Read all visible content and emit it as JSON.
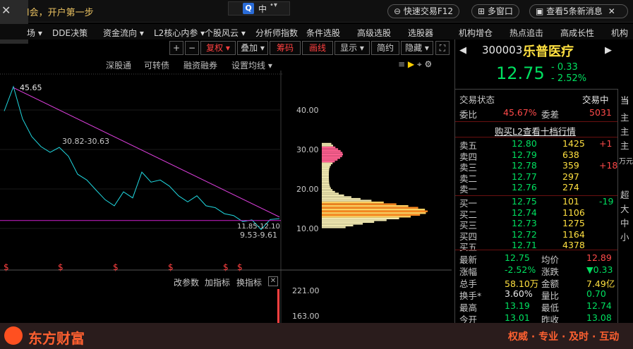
{
  "top": {
    "announcement": "l会，开户第一步",
    "center_glyph": "中",
    "quick_trade": "快速交易F12",
    "multi_window": "多窗口",
    "news": "查看5条新消息"
  },
  "menu": [
    "场",
    "DDE决策",
    "资金流向",
    "L2核心内参",
    "个股风云",
    "分析师指数",
    "条件选股",
    "高级选股",
    "选股器",
    "机构增仓",
    "热点追击",
    "高成长性",
    "机构"
  ],
  "toolbar": {
    "plus": "+",
    "minus": "−",
    "fuquan": "复权",
    "diejia": "叠加",
    "choumao": "筹码",
    "huaxian": "画线",
    "xianshi": "显示",
    "jianyue": "简约",
    "yincang": "隐藏"
  },
  "subtabs": [
    "深股通",
    "可转债",
    "融资融券",
    "设置均线"
  ],
  "chart_data": {
    "type": "line",
    "annotations": [
      "45.65",
      "30.82-30.63",
      "11.85-12.10",
      "9.53-9.61"
    ],
    "yticks": [
      "40.00",
      "30.00",
      "20.00",
      "10.00"
    ],
    "lower_yticks": [
      "221.00",
      "163.00"
    ],
    "marker": "$",
    "series": [
      {
        "values": [
          40,
          45.65,
          38,
          33,
          31,
          29,
          30.8,
          28,
          24,
          22,
          20,
          17,
          16,
          19,
          18,
          24,
          22,
          22,
          21,
          18,
          17,
          18,
          16,
          15,
          14,
          13,
          12,
          11.9,
          10,
          12,
          12.75
        ]
      }
    ],
    "trendline": {
      "from": 45.65,
      "to": 12.9
    },
    "support_level": 12.0
  },
  "lower_panel": {
    "params": "改参数",
    "add": "加指标",
    "switch": "换指标"
  },
  "stock": {
    "code": "300003",
    "name": "乐普医疗",
    "price": "12.75",
    "change": "- 0.33",
    "pct": "- 2.52%",
    "status_label": "交易状态",
    "status_value": "交易中",
    "weibi_label": "委比",
    "weibi_value": "45.67%",
    "weicha_label": "委差",
    "weicha_value": "5031",
    "l2_link": "购买L2查看十档行情"
  },
  "asks": [
    {
      "label": "卖五",
      "price": "12.80",
      "vol": "1425",
      "chg": "+1"
    },
    {
      "label": "卖四",
      "price": "12.79",
      "vol": "638",
      "chg": ""
    },
    {
      "label": "卖三",
      "price": "12.78",
      "vol": "359",
      "chg": "+18"
    },
    {
      "label": "卖二",
      "price": "12.77",
      "vol": "297",
      "chg": ""
    },
    {
      "label": "卖一",
      "price": "12.76",
      "vol": "274",
      "chg": ""
    }
  ],
  "bids": [
    {
      "label": "买一",
      "price": "12.75",
      "vol": "101",
      "chg": "-19"
    },
    {
      "label": "买二",
      "price": "12.74",
      "vol": "1106",
      "chg": ""
    },
    {
      "label": "买三",
      "price": "12.73",
      "vol": "1275",
      "chg": ""
    },
    {
      "label": "买四",
      "price": "12.72",
      "vol": "1164",
      "chg": ""
    },
    {
      "label": "买五",
      "price": "12.71",
      "vol": "4378",
      "chg": ""
    }
  ],
  "stats": [
    {
      "l1": "最新",
      "v1": "12.75",
      "l2": "均价",
      "v2": "12.89"
    },
    {
      "l1": "涨幅",
      "v1": "-2.52%",
      "l2": "涨跌",
      "v2": "▼0.33"
    },
    {
      "l1": "总手",
      "v1": "58.10万",
      "l2": "金额",
      "v2": "7.49亿"
    },
    {
      "l1": "换手*",
      "v1": "3.60%",
      "l2": "量比",
      "v2": "0.70"
    },
    {
      "l1": "最高",
      "v1": "13.19",
      "l2": "最低",
      "v2": "12.74"
    },
    {
      "l1": "今开",
      "v1": "13.01",
      "l2": "昨收",
      "v2": "13.08"
    }
  ],
  "far_right": [
    "当",
    "主",
    "主",
    "主",
    "万元",
    "超",
    "大",
    "中",
    "小"
  ],
  "brand": {
    "name": "东方财富",
    "slogan": "权威 · 专业 · 及时 · 互动"
  },
  "colors": {
    "up": "#ff4a4a",
    "down": "#00e060",
    "accent": "#ff6030",
    "trend": "#e040e0"
  }
}
